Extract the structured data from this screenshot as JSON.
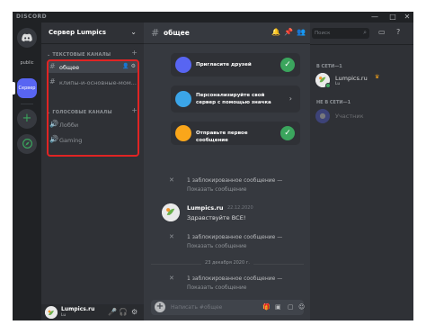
{
  "titlebar": {
    "brand": "DISCORD",
    "minimize": "—",
    "maximize": "□",
    "close": "✕"
  },
  "guilds": {
    "home_icon": "discord-logo-icon",
    "public_label": "public",
    "server_label": "Сервер",
    "add_icon": "+",
    "explore_icon": "compass-icon"
  },
  "sidebar": {
    "server_name": "Сервер Lumpics",
    "text_category": "ТЕКСТОВЫЕ КАНАЛЫ",
    "voice_category": "ГОЛОСОВЫЕ КАНАЛЫ",
    "text_channels": [
      {
        "name": "общее",
        "active": true
      },
      {
        "name": "клипы-и-основные-мом..."
      }
    ],
    "voice_channels": [
      {
        "name": "Лобби"
      },
      {
        "name": "Gaming"
      }
    ]
  },
  "user_panel": {
    "name": "Lumpics.ru",
    "tag": "Lu"
  },
  "channel": {
    "name": "общее"
  },
  "welcome_cards": [
    {
      "text": "Пригласите друзей",
      "done": true,
      "color": "#5865f2"
    },
    {
      "text": "Персонализируйте свой сервер с помощью значка",
      "done": false,
      "color": "#3ba5e8"
    },
    {
      "text": "Отправьте первое сообщение",
      "done": true,
      "color": "#faa61a"
    }
  ],
  "messages": {
    "blocked_text": "1 заблокированное сообщение —",
    "show_text": "Показать сообщение",
    "message": {
      "author": "Lumpics.ru",
      "date": "22.12.2020",
      "body": "Здравствуйте ВСЕ!"
    },
    "divider_date": "23 декабря 2020 г."
  },
  "composer": {
    "placeholder": "Написать #общее"
  },
  "members": {
    "search_placeholder": "Поиск",
    "online_header": "В СЕТИ—1",
    "offline_header": "НЕ В СЕТИ—1",
    "online": [
      {
        "name": "Lumpics.ru",
        "tag": "Lu",
        "owner": true
      }
    ],
    "offline": [
      {
        "name": "Участник"
      }
    ]
  },
  "colors": {
    "accent": "#5865f2",
    "online": "#3ba55d",
    "highlight": "#e02424"
  }
}
